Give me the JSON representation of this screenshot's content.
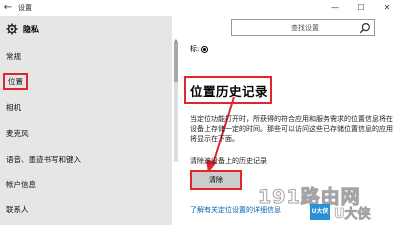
{
  "window": {
    "title": "设置",
    "back_glyph": "←",
    "minimize_glyph": "—",
    "maximize_glyph": "☐",
    "close_glyph": "✕"
  },
  "sidebar": {
    "title": "隐私",
    "items": [
      {
        "label": "常规"
      },
      {
        "label": "位置",
        "selected": true
      },
      {
        "label": "相机"
      },
      {
        "label": "麦克风"
      },
      {
        "label": "语音、墨迹书写和键入"
      },
      {
        "label": "帐户信息"
      },
      {
        "label": "联系人"
      }
    ]
  },
  "search": {
    "placeholder": "查找设置"
  },
  "content": {
    "radio_label": "标:",
    "section_title": "位置历史记录",
    "description": "当定位功能打开时，所获得的符合应用和服务需求的位置信息将在设备上存储一定的时间。那些可以访问这些已存储位置信息的应用将显示在下面。",
    "clear_label_a": "清除这",
    "clear_label_b": "设备上",
    "clear_label_c": "的历史记录",
    "clear_button": "清除",
    "link": "了解有关定位设置的详细信息"
  },
  "watermark": {
    "text": "191路由网",
    "badge": "U大侠",
    "text2": "U大侠"
  },
  "colors": {
    "sidebar_bg": "#e6e6e6",
    "highlight_red": "#e0262d",
    "link_blue": "#0063b1",
    "button_gray": "#cccccc"
  }
}
